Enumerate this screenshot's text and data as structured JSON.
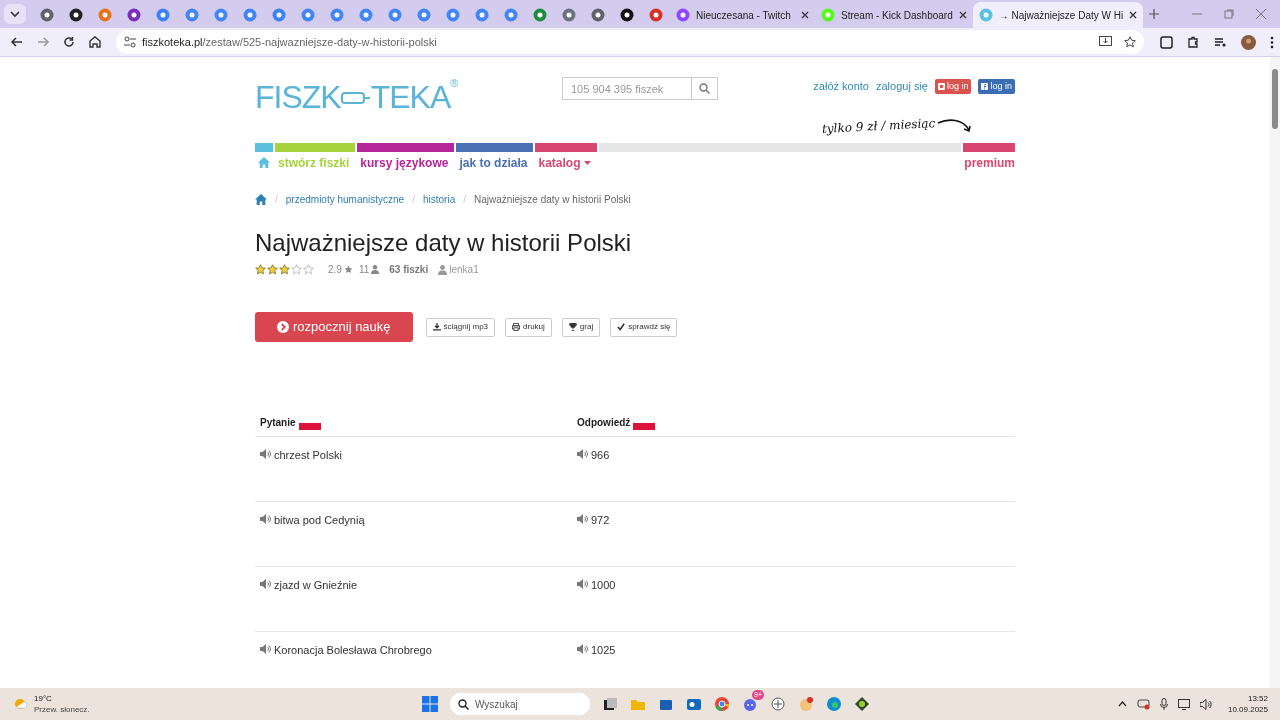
{
  "browser": {
    "tabs": [
      {
        "kind": "icon",
        "color": "#5f6368",
        "selected": false
      },
      {
        "kind": "icon",
        "color": "#202124",
        "selected": false
      },
      {
        "kind": "icon",
        "color": "#e8711c",
        "selected": false
      },
      {
        "kind": "icon",
        "color": "#7b2fbe",
        "selected": false
      },
      {
        "kind": "icon",
        "color": "#3b82f6",
        "selected": false
      },
      {
        "kind": "icon",
        "color": "#4285f4",
        "selected": false
      },
      {
        "kind": "icon",
        "color": "#4285f4",
        "selected": false
      },
      {
        "kind": "icon",
        "color": "#4285f4",
        "selected": false
      },
      {
        "kind": "icon",
        "color": "#3b82f6",
        "selected": false
      },
      {
        "kind": "icon",
        "color": "#4285f4",
        "selected": false
      },
      {
        "kind": "icon",
        "color": "#4285f4",
        "selected": false
      },
      {
        "kind": "icon",
        "color": "#4285f4",
        "selected": false
      },
      {
        "kind": "icon",
        "color": "#4285f4",
        "selected": false
      },
      {
        "kind": "icon",
        "color": "#4285f4",
        "selected": false
      },
      {
        "kind": "icon",
        "color": "#4285f4",
        "selected": false
      },
      {
        "kind": "icon",
        "color": "#4285f4",
        "selected": false
      },
      {
        "kind": "icon",
        "color": "#4285f4",
        "selected": false
      },
      {
        "kind": "icon",
        "color": "#1e8e3e",
        "selected": false
      },
      {
        "kind": "icon",
        "color": "#6b7280",
        "selected": false
      },
      {
        "kind": "icon",
        "color": "#5f6368",
        "selected": false
      },
      {
        "kind": "icon",
        "color": "#111111",
        "selected": false
      },
      {
        "kind": "icon",
        "color": "#d93025",
        "selected": false
      },
      {
        "kind": "titled",
        "color": "#9146ff",
        "title": "Nieuczesana - Twitch",
        "selected": false
      },
      {
        "kind": "titled",
        "color": "#53fc18",
        "title": "Stream - Kick Dashboard",
        "selected": false
      },
      {
        "kind": "titled",
        "color": "#5bc0de",
        "title": "→ Najważniejsze Daty W Hi",
        "selected": true
      }
    ],
    "address": {
      "host": "fiszkoteka.pl",
      "path": "/zestaw/525-najwazniejsze-daty-w-historii-polski"
    }
  },
  "header": {
    "logo": {
      "left": "FISZK",
      "right": "TEKA",
      "mark": "®"
    },
    "search": {
      "placeholder": "105 904 395 fiszek"
    },
    "links": [
      "załóż konto",
      "zaloguj się"
    ],
    "login_buttons": [
      {
        "kind": "google",
        "label": "log in",
        "color": "#d9534f"
      },
      {
        "kind": "facebook",
        "label": "log in",
        "color": "#3b6db3"
      }
    ],
    "tagline": "tylko 9 zł / miesiąc"
  },
  "nav": [
    {
      "kind": "home",
      "color": "#5bc0de"
    },
    {
      "kind": "link",
      "label": "stwórz fiszki",
      "color": "#a6d33b"
    },
    {
      "kind": "link",
      "label": "kursy językowe",
      "color": "#b7259a"
    },
    {
      "kind": "link",
      "label": "jak to działa",
      "color": "#4a6fb5"
    },
    {
      "kind": "dropdown",
      "label": "katalog",
      "color": "#d9466f"
    },
    {
      "kind": "spacer",
      "color": "#e6e6e6"
    },
    {
      "kind": "link",
      "label": "premium",
      "color": "#d9466f"
    }
  ],
  "breadcrumb": [
    {
      "kind": "home"
    },
    {
      "kind": "separator",
      "label": "/"
    },
    {
      "kind": "link",
      "label": "przedmioty humanistyczne"
    },
    {
      "kind": "separator",
      "label": "/"
    },
    {
      "kind": "link",
      "label": "historia"
    },
    {
      "kind": "separator",
      "label": "/"
    },
    {
      "kind": "current",
      "label": "Najważniejsze daty w historii Polski"
    }
  ],
  "title": "Najważniejsze daty w historii Polski",
  "meta": {
    "stars": 3,
    "rating": "2.9",
    "votes": "11",
    "count": "63 fiszki",
    "author": "lenka1"
  },
  "actions": [
    {
      "kind": "primary",
      "label": "rozpocznij naukę"
    },
    {
      "kind": "download",
      "label": "ściągnij mp3"
    },
    {
      "kind": "print",
      "label": "drukuj"
    },
    {
      "kind": "trophy",
      "label": "graj"
    },
    {
      "kind": "check",
      "label": "sprawdź się"
    }
  ],
  "table": {
    "columns": [
      "Pytanie",
      "Odpowiedź"
    ],
    "rows": [
      [
        "chrzest Polski",
        "966"
      ],
      [
        "bitwa pod Cedynią",
        "972"
      ],
      [
        "zjazd w Gnieźnie",
        "1000"
      ],
      [
        "Koronacja Bolesława Chrobrego",
        "1025"
      ]
    ]
  },
  "taskbar": {
    "weather": {
      "temp": "19°C",
      "desc": "Przew. słonecz."
    },
    "search": {
      "placeholder": "Wyszukaj"
    },
    "badge": "9+",
    "time": "13:52",
    "date": "10.09.2025"
  }
}
